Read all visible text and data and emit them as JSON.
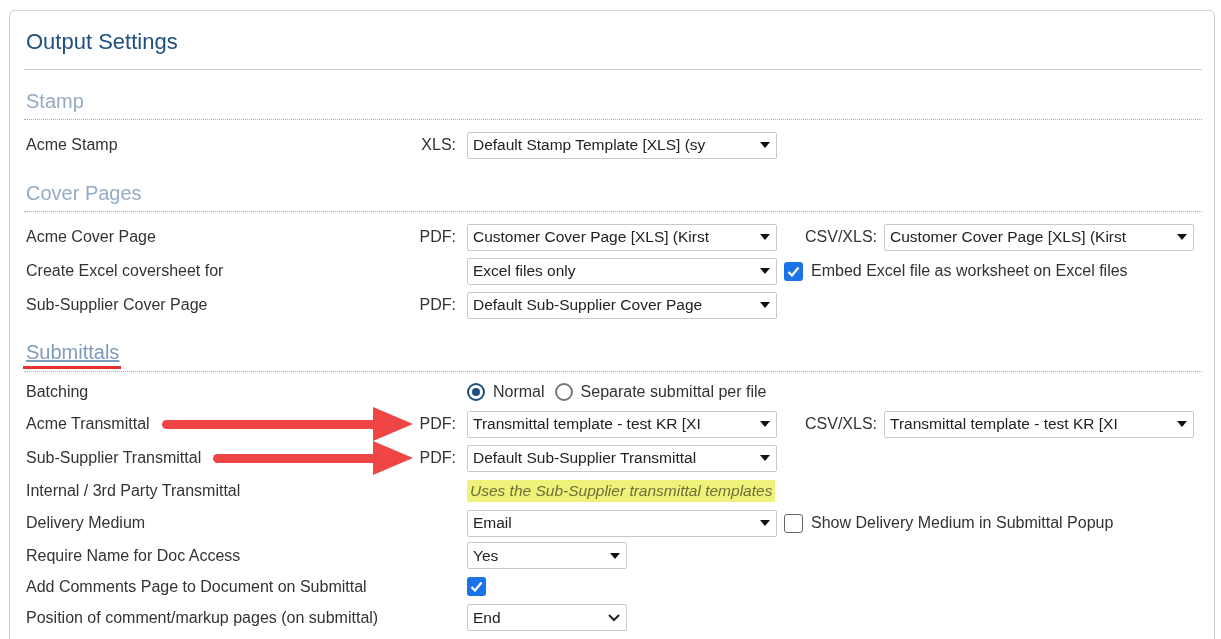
{
  "title": "Output Settings",
  "sections": [
    {
      "heading": "Stamp",
      "marked": false,
      "rows": [
        {
          "kind": "select",
          "label": "Acme Stamp",
          "arrow": false,
          "prefix": "XLS:",
          "value": "Default Stamp Template [XLS] (sy"
        }
      ]
    },
    {
      "heading": "Cover Pages",
      "marked": false,
      "rows": [
        {
          "kind": "select",
          "label": "Acme Cover Page",
          "arrow": false,
          "prefix": "PDF:",
          "value": "Customer Cover Page [XLS] (Kirst",
          "secondary": {
            "prefix": "CSV/XLS:",
            "value": "Customer Cover Page [XLS] (Kirst"
          }
        },
        {
          "kind": "select",
          "label": "Create Excel coversheet for",
          "arrow": false,
          "value": "Excel files only",
          "check": {
            "checked": true,
            "label": "Embed Excel file as worksheet on Excel files"
          }
        },
        {
          "kind": "select",
          "label": "Sub-Supplier Cover Page",
          "arrow": false,
          "prefix": "PDF:",
          "value": "Default Sub-Supplier Cover Page"
        }
      ]
    },
    {
      "heading": "Submittals",
      "marked": true,
      "rows": [
        {
          "kind": "radio",
          "label": "Batching",
          "options": [
            {
              "label": "Normal",
              "selected": true
            },
            {
              "label": "Separate submittal per file",
              "selected": false
            }
          ]
        },
        {
          "kind": "select",
          "label": "Acme Transmittal",
          "arrow": true,
          "prefix": "PDF:",
          "value": "Transmittal template - test KR [XI",
          "secondary": {
            "prefix": "CSV/XLS:",
            "value": "Transmittal template - test KR [XI"
          }
        },
        {
          "kind": "select",
          "label": "Sub-Supplier Transmittal",
          "arrow": true,
          "prefix": "PDF:",
          "value": "Default Sub-Supplier Transmittal"
        },
        {
          "kind": "note",
          "label": "Internal / 3rd Party Transmittal",
          "note": "Uses the Sub-Supplier transmittal templates"
        },
        {
          "kind": "select",
          "label": "Delivery Medium",
          "arrow": false,
          "value": "Email",
          "check": {
            "checked": false,
            "label": "Show Delivery Medium in Submittal Popup"
          }
        },
        {
          "kind": "short-select",
          "label": "Require Name for Doc Access",
          "value": "Yes"
        },
        {
          "kind": "checkbox",
          "label": "Add Comments Page to Document on Submittal",
          "checked": true
        },
        {
          "kind": "chevron-select",
          "label": "Position of comment/markup pages (on submittal)",
          "value": "End"
        }
      ]
    }
  ]
}
